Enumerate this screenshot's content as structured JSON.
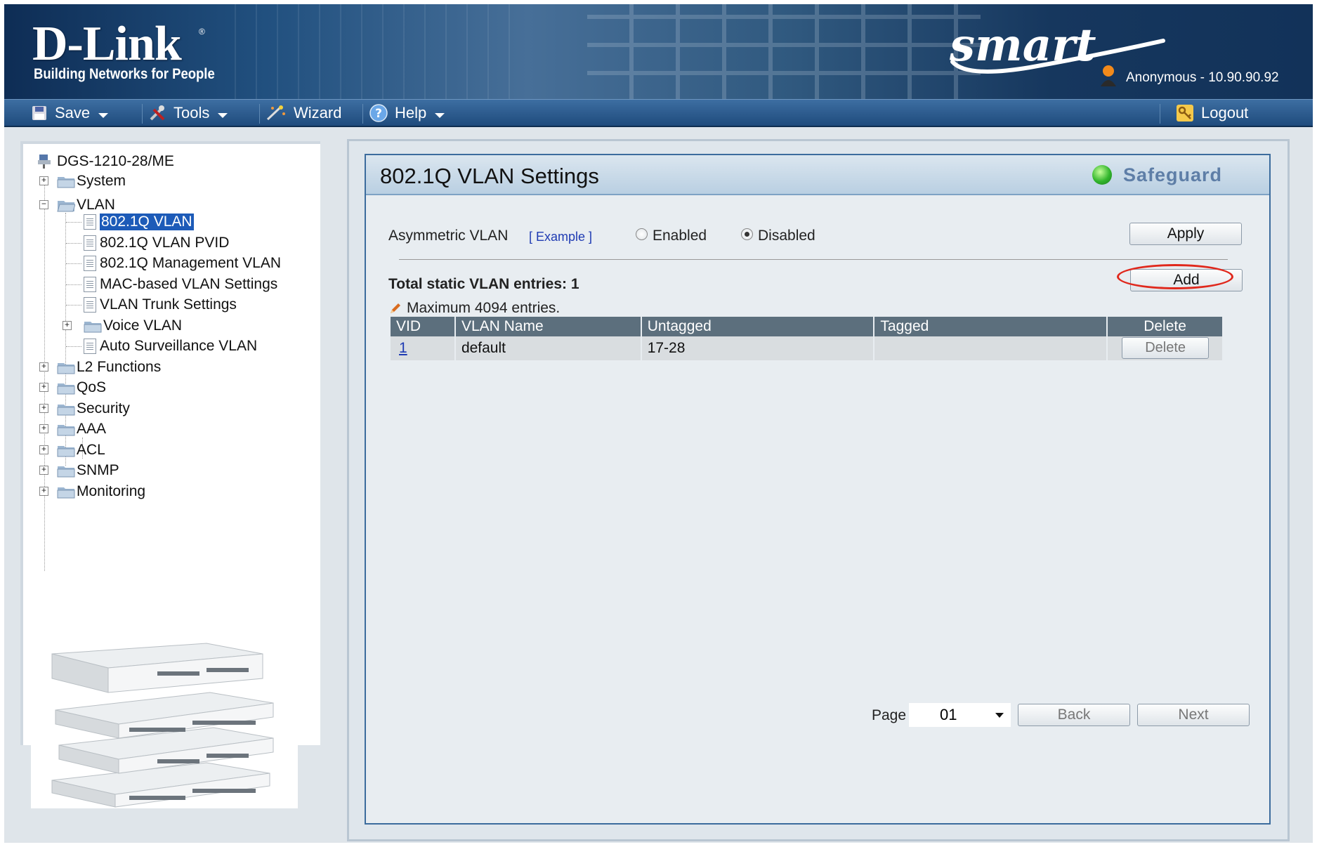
{
  "brand": {
    "logo": "D-Link",
    "reg": "®",
    "tagline": "Building Networks for People",
    "product": "smart"
  },
  "user": {
    "label": "Anonymous - 10.90.90.92"
  },
  "toolbar": {
    "save": "Save",
    "tools": "Tools",
    "wizard": "Wizard",
    "help": "Help",
    "logout": "Logout"
  },
  "tree": {
    "root": "DGS-1210-28/ME",
    "items": [
      "System",
      "VLAN",
      "802.1Q VLAN",
      "802.1Q VLAN PVID",
      "802.1Q Management VLAN",
      "MAC-based VLAN Settings",
      "VLAN Trunk Settings",
      "Voice VLAN",
      "Auto Surveillance VLAN",
      "L2 Functions",
      "QoS",
      "Security",
      "AAA",
      "ACL",
      "SNMP",
      "Monitoring"
    ],
    "selected": "802.1Q VLAN"
  },
  "panel": {
    "title": "802.1Q VLAN Settings",
    "safeguard": "Safeguard",
    "asym_label": "Asymmetric VLAN",
    "example_link": "[ Example ]",
    "enabled": "Enabled",
    "disabled": "Disabled",
    "asym_value": "Disabled",
    "apply": "Apply",
    "total": "Total static VLAN entries: 1",
    "max": "Maximum 4094 entries.",
    "add": "Add",
    "table": {
      "headers": [
        "VID",
        "VLAN Name",
        "Untagged",
        "Tagged",
        "Delete"
      ],
      "rows": [
        {
          "vid": "1",
          "name": "default",
          "untagged": "17-28",
          "tagged": "",
          "delete": "Delete"
        }
      ]
    },
    "pager": {
      "label": "Page",
      "value": "01",
      "back": "Back",
      "next": "Next"
    }
  },
  "colors": {
    "header": "#1f4b7d",
    "selection": "#1d5bb8",
    "annotation": "#e0281c",
    "safeguard_dot": "#32b52c"
  }
}
